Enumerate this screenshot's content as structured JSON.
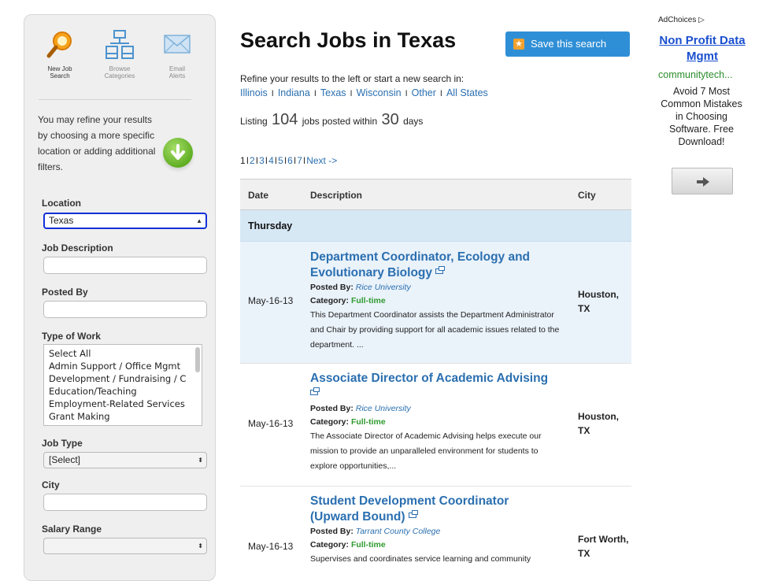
{
  "sidebar": {
    "tools": [
      {
        "label_line1": "New Job",
        "label_line2": "Search",
        "icon": "magnifier-icon"
      },
      {
        "label_line1": "Browse",
        "label_line2": "Categories",
        "icon": "sitemap-icon"
      },
      {
        "label_line1": "Email",
        "label_line2": "Alerts",
        "icon": "envelope-icon"
      }
    ],
    "refine_text": "You may refine your results by choosing a more specific location or adding additional filters.",
    "location_label": "Location",
    "location_value": "Texas",
    "job_description_label": "Job Description",
    "posted_by_label": "Posted By",
    "type_of_work_label": "Type of Work",
    "type_of_work_options": [
      "Select All",
      "Admin Support / Office Mgmt",
      "Development / Fundraising / C",
      "Education/Teaching",
      "Employment-Related Services",
      "Grant Making"
    ],
    "job_type_label": "Job Type",
    "job_type_value": "[Select]",
    "city_label": "City",
    "salary_label": "Salary Range",
    "salary_value": ""
  },
  "main": {
    "title": "Search Jobs in Texas",
    "save_button": "Save this search",
    "refine_text": "Refine your results to the left or start a new search in:",
    "states": [
      "Illinois",
      "Indiana",
      "Texas",
      "Wisconsin",
      "Other",
      "All States"
    ],
    "state_separator": "I",
    "listing_prefix": "Listing",
    "listing_count": "104",
    "listing_middle": "jobs posted within",
    "listing_days": "30",
    "listing_suffix": "days",
    "pager": {
      "current": "1",
      "pages": [
        "2",
        "3",
        "4",
        "5",
        "6",
        "7"
      ],
      "separator": "I",
      "next": "Next ->"
    },
    "table": {
      "columns": [
        "Date",
        "Description",
        "City"
      ],
      "day": "Thursday",
      "posted_by_label": "Posted By:",
      "category_label": "Category:",
      "jobs": [
        {
          "date": "May-16-13",
          "title": "Department Coordinator, Ecology and Evolutionary Biology",
          "posted_by": "Rice University",
          "category": "Full-time",
          "text": "This Department Coordinator assists the Department Administrator and Chair by providing support for all academic issues related to the department. ...",
          "city": "Houston, TX"
        },
        {
          "date": "May-16-13",
          "title": "Associate Director of Academic Advising",
          "posted_by": "Rice University",
          "category": "Full-time",
          "text": "The Associate Director of Academic Advising helps execute our mission to provide an unparalleled environment for students to explore opportunities,...",
          "city": "Houston, TX"
        },
        {
          "date": "May-16-13",
          "title": "Student Development Coordinator (Upward Bound)",
          "posted_by": "Tarrant County College",
          "category": "Full-time",
          "text": "Supervises and coordinates service learning and community",
          "city": "Fort Worth, TX"
        }
      ]
    }
  },
  "ad": {
    "adchoices": "AdChoices",
    "title": "Non Profit Data Mgmt",
    "url": "communitytech...",
    "body": "Avoid 7 Most Common Mistakes in Choosing Software. Free Download!"
  },
  "colors": {
    "link": "#2a6fb0",
    "save_button": "#2f8fd6",
    "category_green": "#2f9b2f",
    "ad_title": "#1a4fcf",
    "ad_url": "#2b8c2b",
    "day_row": "#d7e8f5"
  }
}
